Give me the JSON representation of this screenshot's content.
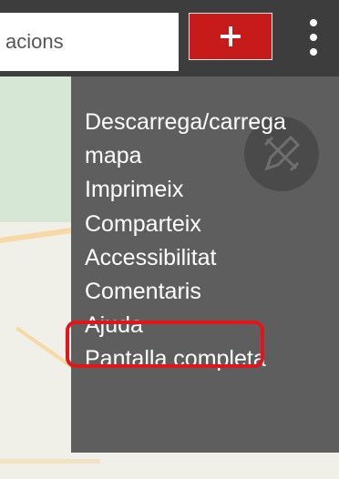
{
  "header": {
    "search_text": "acions",
    "add_button_label": "+",
    "more_button_icon": "more-vertical-icon"
  },
  "menu": {
    "items": [
      {
        "label": "Descarrega/carrega"
      },
      {
        "label": "mapa"
      },
      {
        "label": "Imprimeix"
      },
      {
        "label": "Comparteix"
      },
      {
        "label": "Accessibilitat"
      },
      {
        "label": "Comentaris"
      },
      {
        "label": "Ajuda"
      },
      {
        "label": "Pantalla completa"
      }
    ],
    "highlighted_item": "Comentaris",
    "edit_icon": "pencil-ruler-icon"
  },
  "colors": {
    "topbar": "#3d3d3d",
    "add_button": "#c71a1a",
    "menu_bg": "#5e5e5e",
    "highlight": "#e3141c"
  }
}
